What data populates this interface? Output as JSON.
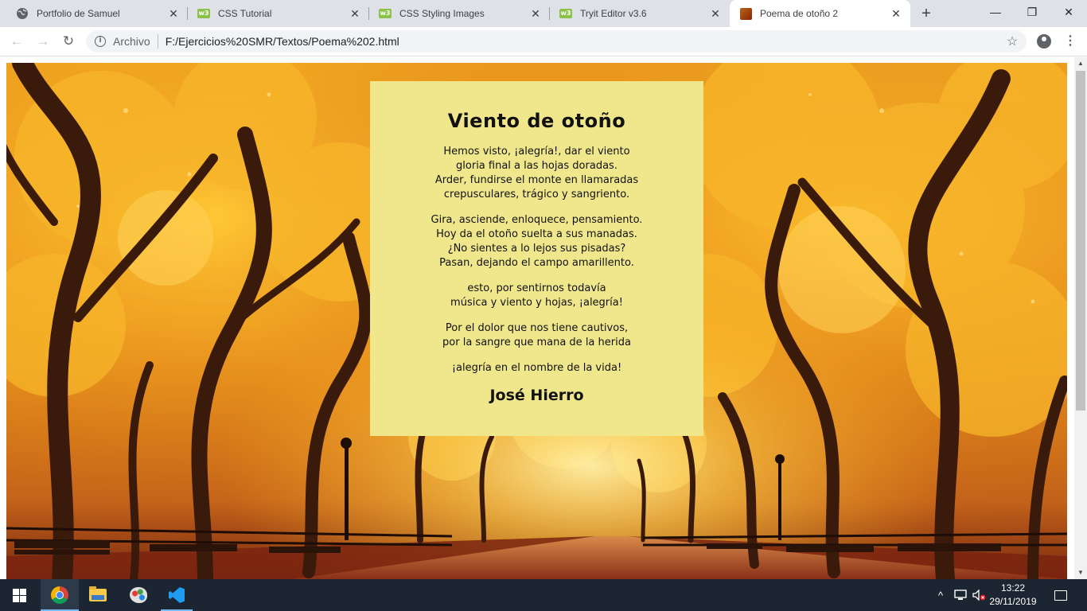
{
  "browser": {
    "tabs": [
      {
        "title": "Portfolio de Samuel",
        "icon": "globe-icon",
        "active": false
      },
      {
        "title": "CSS Tutorial",
        "icon": "w3schools-icon",
        "active": false
      },
      {
        "title": "CSS Styling Images",
        "icon": "w3schools-icon",
        "active": false
      },
      {
        "title": "Tryit Editor v3.6",
        "icon": "w3schools-icon",
        "active": false
      },
      {
        "title": "Poema de otoño 2",
        "icon": "image-icon",
        "active": true
      }
    ],
    "favicon_w3_text": "w3",
    "new_tab_glyph": "+",
    "window_controls": {
      "minimize": "—",
      "maximize": "❐",
      "close": "✕"
    },
    "tab_close_glyph": "✕"
  },
  "toolbar": {
    "back_glyph": "←",
    "forward_glyph": "→",
    "reload_glyph": "↻",
    "info_glyph": "i",
    "scheme_label": "Archivo",
    "url": "F:/Ejercicios%20SMR/Textos/Poema%202.html",
    "star_glyph": "☆",
    "menu_glyph": "⋮"
  },
  "page": {
    "background_image": "autumn-park-avenue",
    "card_color": "#f0e68c",
    "poem": {
      "title": "Viento de otoño",
      "stanzas": [
        [
          "Hemos visto, ¡alegría!, dar el viento",
          "gloria final a las hojas doradas.",
          "Arder, fundirse el monte en llamaradas",
          "crepusculares, trágico y sangriento."
        ],
        [
          "Gira, asciende, enloquece, pensamiento.",
          "Hoy da el otoño suelta a sus manadas.",
          "¿No sientes a lo lejos sus pisadas?",
          "Pasan, dejando el campo amarillento."
        ],
        [
          "esto, por sentirnos todavía",
          "música y viento y hojas, ¡alegría!"
        ],
        [
          "Por el dolor que nos tiene cautivos,",
          "por la sangre que mana de la herida"
        ],
        [
          "¡alegría en el nombre de la vida!"
        ]
      ],
      "author": "José Hierro"
    }
  },
  "scrollbar": {
    "up_glyph": "▲",
    "down_glyph": "▼"
  },
  "taskbar": {
    "apps": [
      "start-button",
      "chrome",
      "file-explorer",
      "paint",
      "vscode"
    ],
    "tray": {
      "chevron_glyph": "^",
      "network_glyph": "⌨",
      "volume_glyph": "🔇"
    },
    "time": "13:22",
    "date": "29/11/2019"
  },
  "colors": {
    "tab_strip": "#dee1e6",
    "taskbar": "#1c2633",
    "accent": "#76b9ed"
  }
}
